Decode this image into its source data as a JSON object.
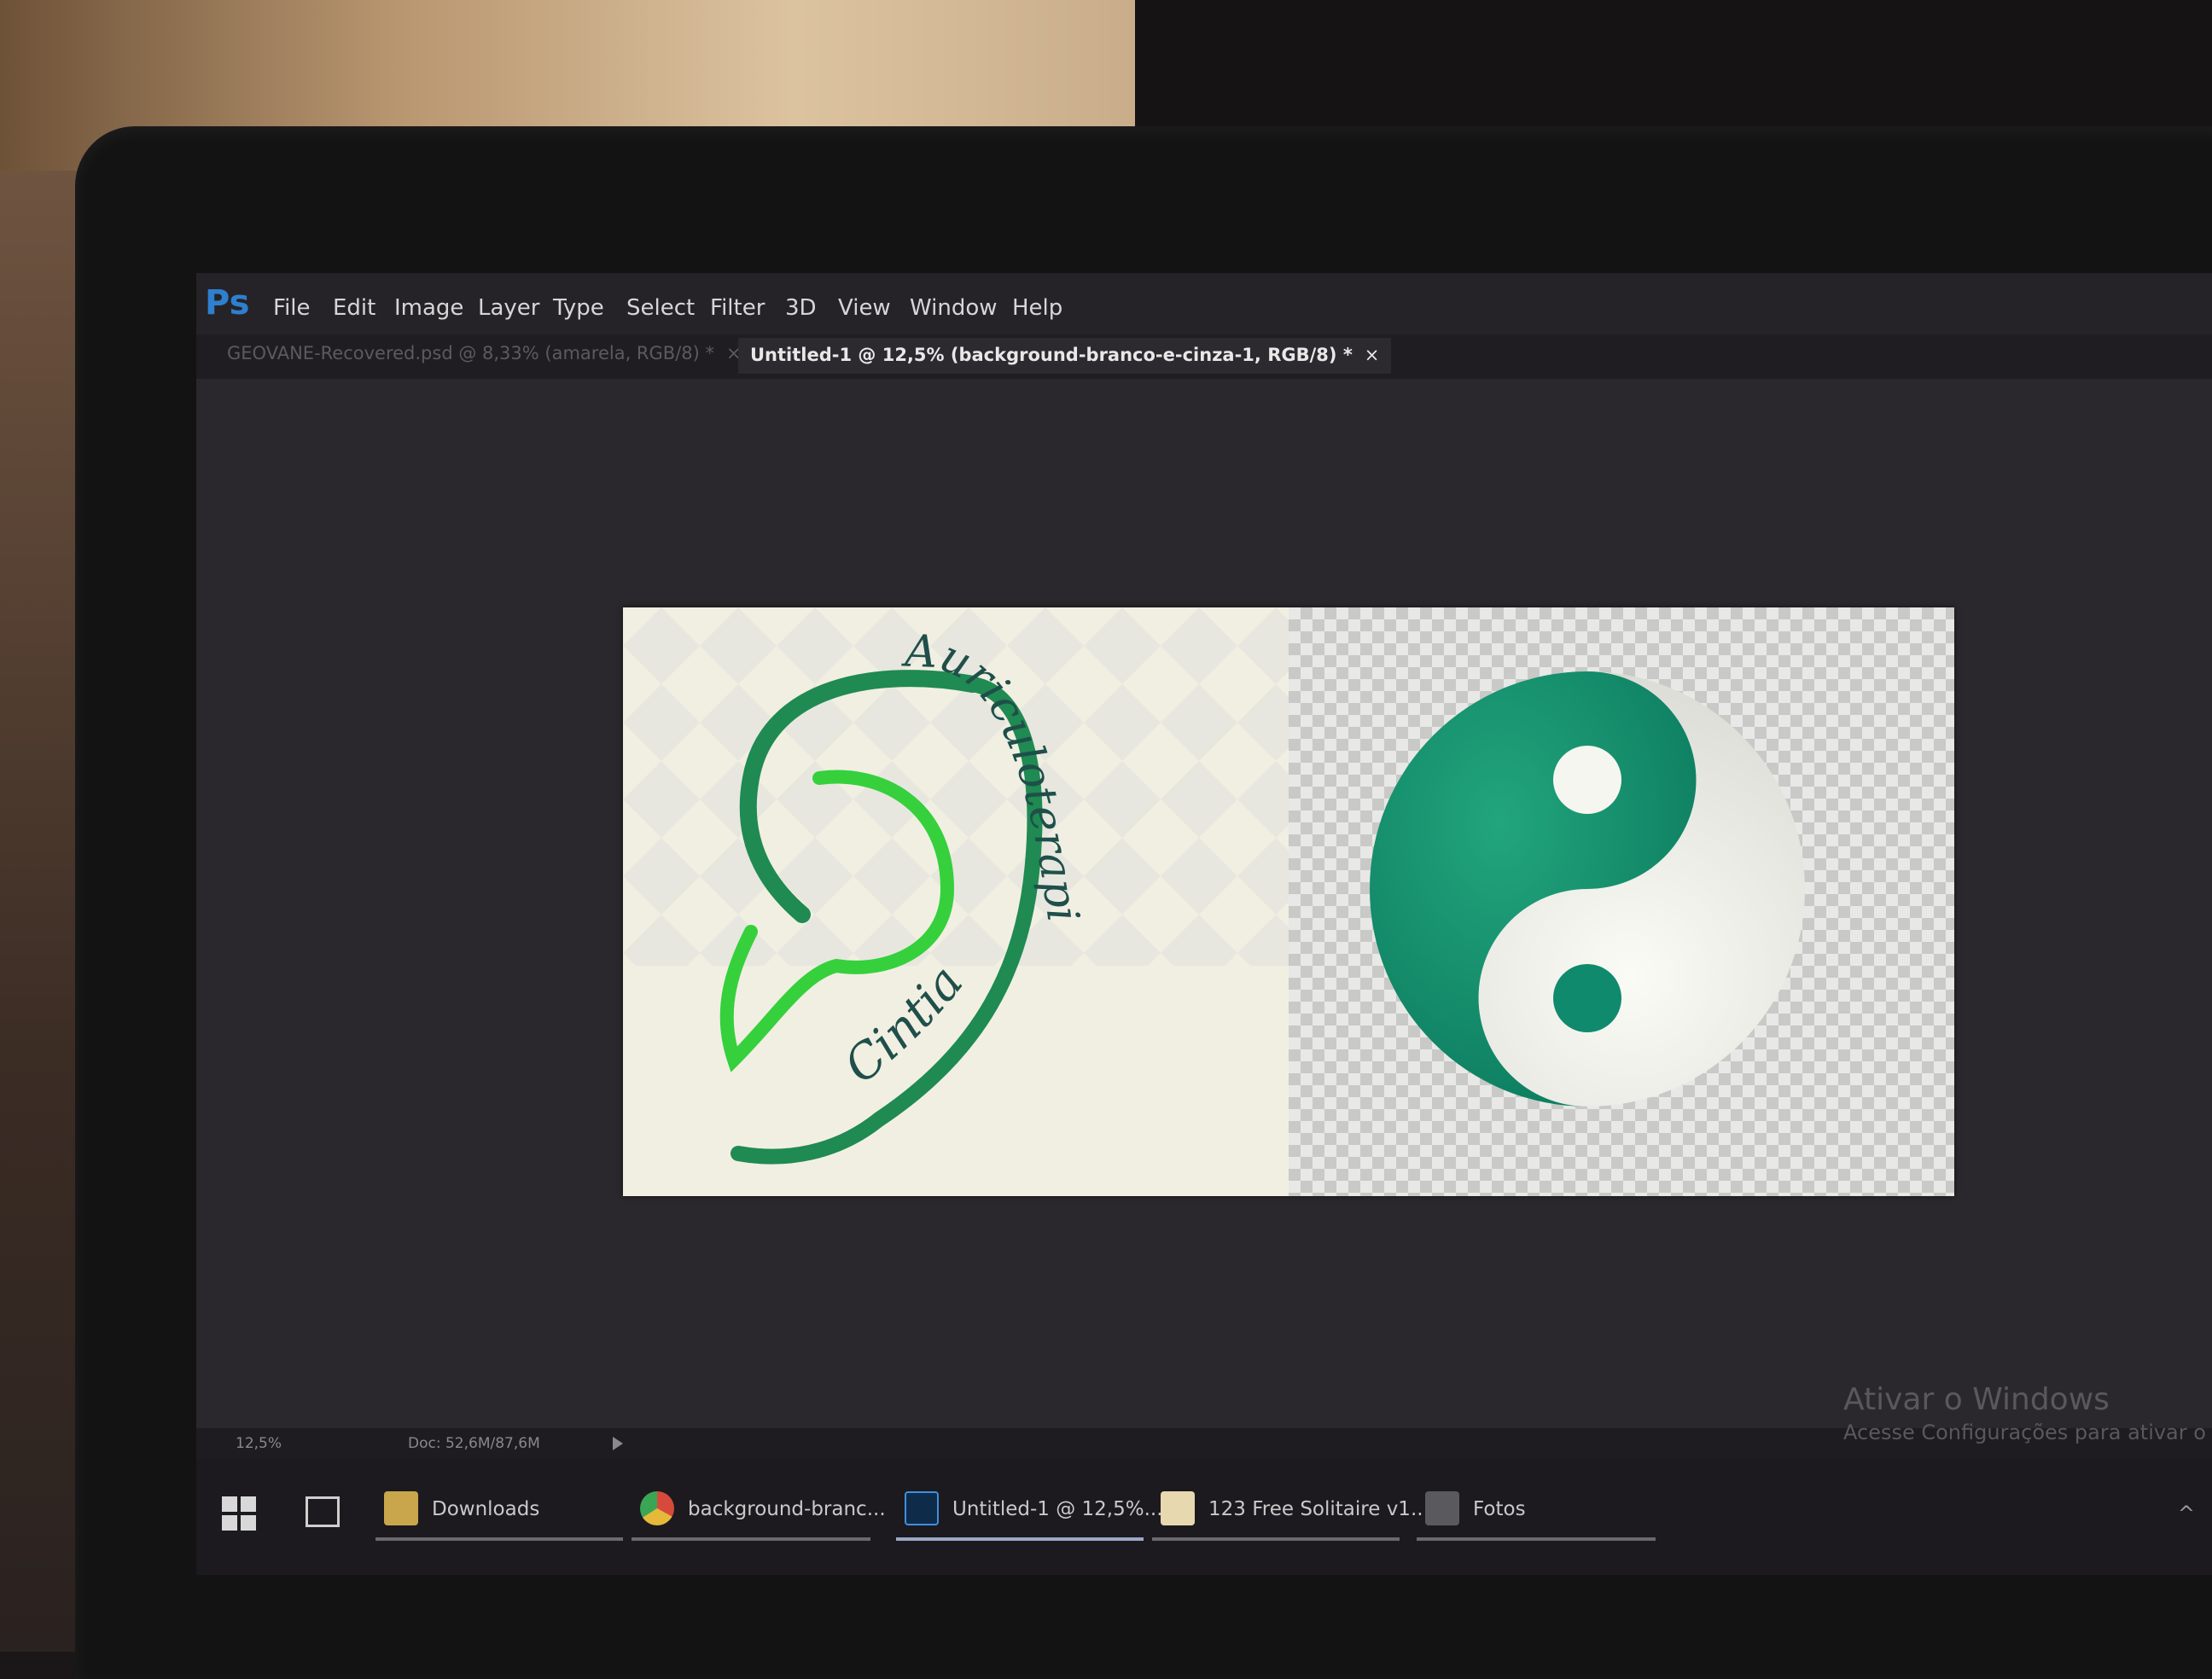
{
  "menu": {
    "app_logo": "Ps",
    "items": [
      "File",
      "Edit",
      "Image",
      "Layer",
      "Type",
      "Select",
      "Filter",
      "3D",
      "View",
      "Window",
      "Help"
    ]
  },
  "tabs": [
    {
      "title": "GEOVANE-Recovered.psd @ 8,33% (amarela, RGB/8) *",
      "close": "×",
      "active": false
    },
    {
      "title": "Untitled-1 @ 12,5% (background-branco-e-cinza-1, RGB/8) *",
      "close": "×",
      "active": true
    }
  ],
  "canvas": {
    "logo_title": "Auriculoterapia",
    "logo_name": "Cintia",
    "colors": {
      "dark_green": "#1f8a52",
      "light_green": "#35d03c",
      "teal": "#0f8a6c",
      "ink": "#1f4f4a"
    }
  },
  "status": {
    "zoom": "12,5%",
    "doc": "Doc: 52,6M/87,6M"
  },
  "watermark": {
    "line1": "Ativar o Windows",
    "line2": "Acesse Configurações para ativar o"
  },
  "taskbar": {
    "items": [
      {
        "label": "Downloads",
        "icon": "folder-icon"
      },
      {
        "label": "background-branc...",
        "icon": "chrome-icon"
      },
      {
        "label": "Untitled-1 @ 12,5%...",
        "icon": "photoshop-icon"
      },
      {
        "label": "123 Free Solitaire v1...",
        "icon": "solitaire-icon"
      },
      {
        "label": "Fotos",
        "icon": "photos-icon"
      }
    ]
  }
}
